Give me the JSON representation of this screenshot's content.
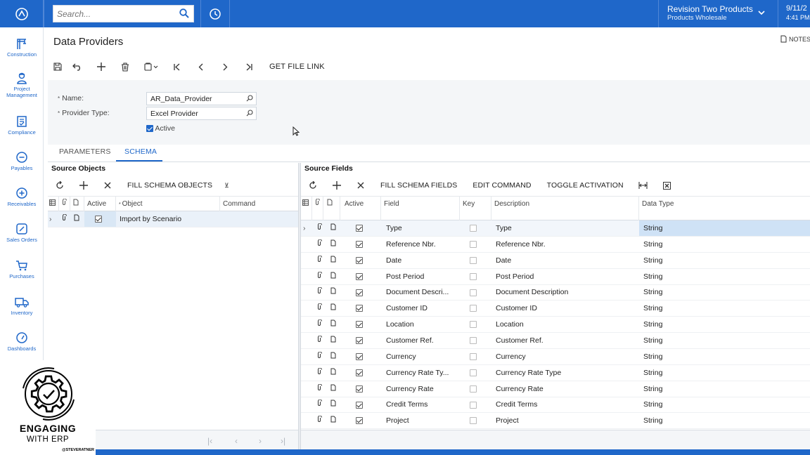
{
  "topbar": {
    "search_placeholder": "Search...",
    "company_name": "Revision Two Products",
    "company_sub": "Products Wholesale",
    "date": "9/11/2",
    "time": "4:41 PM"
  },
  "sidebar": {
    "items": [
      {
        "label": "Construction",
        "icon": "crane-icon"
      },
      {
        "label": "Project Management",
        "icon": "worker-icon"
      },
      {
        "label": "Compliance",
        "icon": "document-check-icon"
      },
      {
        "label": "Payables",
        "icon": "minus-circle-icon"
      },
      {
        "label": "Receivables",
        "icon": "plus-circle-icon"
      },
      {
        "label": "Sales Orders",
        "icon": "pencil-icon"
      },
      {
        "label": "Purchases",
        "icon": "cart-icon"
      },
      {
        "label": "Inventory",
        "icon": "truck-icon"
      },
      {
        "label": "Dashboards",
        "icon": "gauge-icon"
      }
    ]
  },
  "page": {
    "title": "Data Providers",
    "notes_label": "NOTES",
    "get_file_link": "GET FILE LINK"
  },
  "form": {
    "name_label": "Name:",
    "name_value": "AR_Data_Provider",
    "provider_type_label": "Provider Type:",
    "provider_type_value": "Excel Provider",
    "active_label": "Active"
  },
  "tabs": [
    "PARAMETERS",
    "SCHEMA"
  ],
  "source_objects": {
    "title": "Source Objects",
    "fill_label": "FILL SCHEMA OBJECTS",
    "extra_icon": "⊻",
    "columns": [
      "Active",
      "Object",
      "Command"
    ],
    "rows": [
      {
        "active": true,
        "object": "Import by Scenario",
        "command": ""
      }
    ]
  },
  "source_fields": {
    "title": "Source Fields",
    "actions": [
      "FILL SCHEMA FIELDS",
      "EDIT COMMAND",
      "TOGGLE ACTIVATION"
    ],
    "columns": [
      "Active",
      "Field",
      "Key",
      "Description",
      "Data Type"
    ],
    "rows": [
      {
        "active": true,
        "field": "Type",
        "key": false,
        "description": "Type",
        "data_type": "String"
      },
      {
        "active": true,
        "field": "Reference Nbr.",
        "key": false,
        "description": "Reference Nbr.",
        "data_type": "String"
      },
      {
        "active": true,
        "field": "Date",
        "key": false,
        "description": "Date",
        "data_type": "String"
      },
      {
        "active": true,
        "field": "Post Period",
        "key": false,
        "description": "Post Period",
        "data_type": "String"
      },
      {
        "active": true,
        "field": "Document Descri...",
        "key": false,
        "description": "Document Description",
        "data_type": "String"
      },
      {
        "active": true,
        "field": "Customer ID",
        "key": false,
        "description": "Customer ID",
        "data_type": "String"
      },
      {
        "active": true,
        "field": "Location",
        "key": false,
        "description": "Location",
        "data_type": "String"
      },
      {
        "active": true,
        "field": "Customer Ref.",
        "key": false,
        "description": "Customer Ref.",
        "data_type": "String"
      },
      {
        "active": true,
        "field": "Currency",
        "key": false,
        "description": "Currency",
        "data_type": "String"
      },
      {
        "active": true,
        "field": "Currency Rate Ty...",
        "key": false,
        "description": "Currency Rate Type",
        "data_type": "String"
      },
      {
        "active": true,
        "field": "Currency Rate",
        "key": false,
        "description": "Currency Rate",
        "data_type": "String"
      },
      {
        "active": true,
        "field": "Credit Terms",
        "key": false,
        "description": "Credit Terms",
        "data_type": "String"
      },
      {
        "active": true,
        "field": "Project",
        "key": false,
        "description": "Project",
        "data_type": "String"
      }
    ]
  },
  "watermark": {
    "line1": "ENGAGING",
    "line2": "WITH ERP",
    "line3": "@STEVERATNER"
  },
  "colors": {
    "brand": "#1f67c9",
    "selected_row": "#cfe2f6",
    "panel_bg": "#f4f6f8"
  }
}
